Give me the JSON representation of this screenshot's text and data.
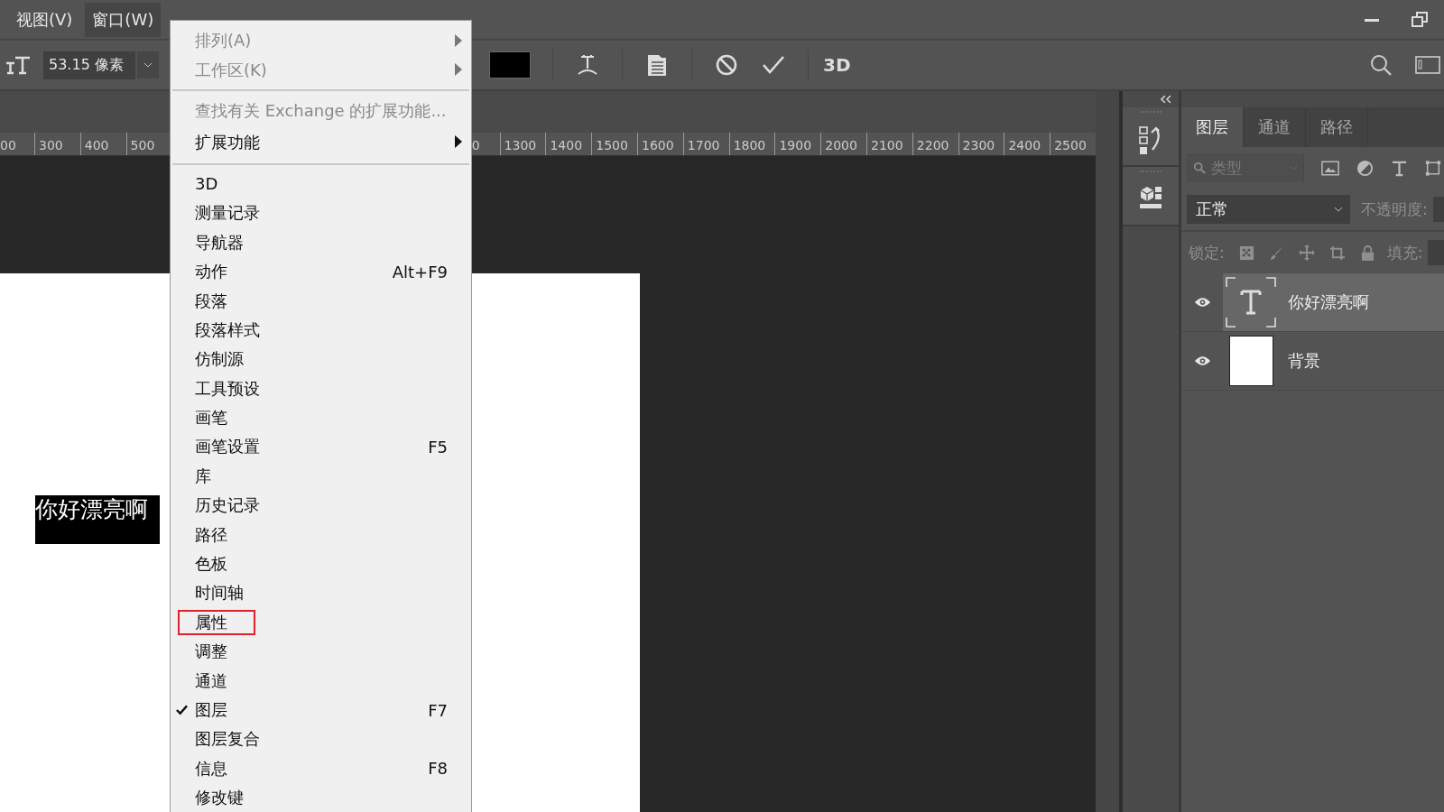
{
  "menubar": [
    {
      "label": "视图(V)",
      "selected": false
    },
    {
      "label": "窗口(W)",
      "selected": true
    }
  ],
  "toolbar": {
    "font_size": "53.15 像素",
    "button_3d": "3D"
  },
  "ruler": {
    "left_labels": [
      "00",
      "300",
      "400",
      "500"
    ],
    "right_labels": [
      "0",
      "1300",
      "1400",
      "1500",
      "1600",
      "1700",
      "1800",
      "1900",
      "2000",
      "2100",
      "2200",
      "2300",
      "2400",
      "2500"
    ]
  },
  "canvas": {
    "text": "你好漂亮啊"
  },
  "menu": {
    "items": [
      {
        "kind": "item",
        "label": "排列(A)",
        "disabled": true,
        "submenu": true,
        "checked": false,
        "highlighted": false
      },
      {
        "kind": "item",
        "label": "工作区(K)",
        "disabled": true,
        "submenu": true,
        "checked": false,
        "highlighted": false
      },
      {
        "kind": "separator"
      },
      {
        "kind": "item",
        "label": "查找有关 Exchange 的扩展功能...",
        "disabled": true,
        "submenu": false,
        "checked": false,
        "highlighted": false
      },
      {
        "kind": "item",
        "label": "扩展功能",
        "disabled": false,
        "submenu": true,
        "checked": false,
        "highlighted": false
      },
      {
        "kind": "separator"
      },
      {
        "kind": "item",
        "label": "3D",
        "disabled": false,
        "submenu": false,
        "checked": false,
        "highlighted": false
      },
      {
        "kind": "item",
        "label": "测量记录",
        "disabled": false,
        "submenu": false,
        "checked": false,
        "highlighted": false
      },
      {
        "kind": "item",
        "label": "导航器",
        "disabled": false,
        "submenu": false,
        "checked": false,
        "highlighted": false
      },
      {
        "kind": "item",
        "label": "动作",
        "shortcut": "Alt+F9",
        "disabled": false,
        "submenu": false,
        "checked": false,
        "highlighted": false
      },
      {
        "kind": "item",
        "label": "段落",
        "disabled": false,
        "submenu": false,
        "checked": false,
        "highlighted": false
      },
      {
        "kind": "item",
        "label": "段落样式",
        "disabled": false,
        "submenu": false,
        "checked": false,
        "highlighted": false
      },
      {
        "kind": "item",
        "label": "仿制源",
        "disabled": false,
        "submenu": false,
        "checked": false,
        "highlighted": false
      },
      {
        "kind": "item",
        "label": "工具预设",
        "disabled": false,
        "submenu": false,
        "checked": false,
        "highlighted": false
      },
      {
        "kind": "item",
        "label": "画笔",
        "disabled": false,
        "submenu": false,
        "checked": false,
        "highlighted": false
      },
      {
        "kind": "item",
        "label": "画笔设置",
        "shortcut": "F5",
        "disabled": false,
        "submenu": false,
        "checked": false,
        "highlighted": false
      },
      {
        "kind": "item",
        "label": "库",
        "disabled": false,
        "submenu": false,
        "checked": false,
        "highlighted": false
      },
      {
        "kind": "item",
        "label": "历史记录",
        "disabled": false,
        "submenu": false,
        "checked": false,
        "highlighted": false
      },
      {
        "kind": "item",
        "label": "路径",
        "disabled": false,
        "submenu": false,
        "checked": false,
        "highlighted": false
      },
      {
        "kind": "item",
        "label": "色板",
        "disabled": false,
        "submenu": false,
        "checked": false,
        "highlighted": false
      },
      {
        "kind": "item",
        "label": "时间轴",
        "disabled": false,
        "submenu": false,
        "checked": false,
        "highlighted": false
      },
      {
        "kind": "item",
        "label": "属性",
        "disabled": false,
        "submenu": false,
        "checked": false,
        "highlighted": true
      },
      {
        "kind": "item",
        "label": "调整",
        "disabled": false,
        "submenu": false,
        "checked": false,
        "highlighted": false
      },
      {
        "kind": "item",
        "label": "通道",
        "disabled": false,
        "submenu": false,
        "checked": false,
        "highlighted": false
      },
      {
        "kind": "item",
        "label": "图层",
        "shortcut": "F7",
        "disabled": false,
        "submenu": false,
        "checked": true,
        "highlighted": false
      },
      {
        "kind": "item",
        "label": "图层复合",
        "disabled": false,
        "submenu": false,
        "checked": false,
        "highlighted": false
      },
      {
        "kind": "item",
        "label": "信息",
        "shortcut": "F8",
        "disabled": false,
        "submenu": false,
        "checked": false,
        "highlighted": false
      },
      {
        "kind": "item",
        "label": "修改键",
        "disabled": false,
        "submenu": false,
        "checked": false,
        "highlighted": false
      }
    ]
  },
  "layers_panel": {
    "tabs": [
      {
        "label": "图层",
        "selected": true
      },
      {
        "label": "通道",
        "selected": false
      },
      {
        "label": "路径",
        "selected": false
      }
    ],
    "filter": {
      "placeholder": "类型"
    },
    "blend_mode": "正常",
    "opacity_label": "不透明度:",
    "lock_label": "锁定:",
    "fill_label": "填充:",
    "layers": [
      {
        "kind": "text",
        "name": "你好漂亮啊",
        "visible": true,
        "selected": true
      },
      {
        "kind": "image",
        "name": "背景",
        "visible": true,
        "selected": false
      }
    ]
  }
}
